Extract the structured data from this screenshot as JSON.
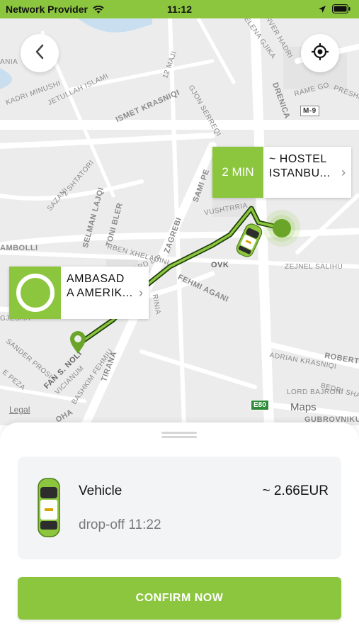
{
  "status": {
    "carrier": "Network Provider",
    "time": "11:12"
  },
  "map": {
    "streets": [
      {
        "name": "KADRI MINUSHI"
      },
      {
        "name": "JETULLAH ISLAMI"
      },
      {
        "name": "ISMET KRASNIQI"
      },
      {
        "name": "12 MAJI"
      },
      {
        "name": "GJON SERREQI"
      },
      {
        "name": "ELENA GJIKA"
      },
      {
        "name": "ENVER HADRI"
      },
      {
        "name": "DRENICA"
      },
      {
        "name": "RAME GO"
      },
      {
        "name": "PRESHE"
      },
      {
        "name": "M-9"
      },
      {
        "name": "2 SHTATORI"
      },
      {
        "name": "SAZANI"
      },
      {
        "name": "SELMAN LAJQI"
      },
      {
        "name": "TONI BLER"
      },
      {
        "name": "ZAGREBI"
      },
      {
        "name": "SAMI PE"
      },
      {
        "name": "VUSHTRRIA"
      },
      {
        "name": "AMBOLLI"
      },
      {
        "name": "RBEN XHELADINI"
      },
      {
        "name": "UARD LIR"
      },
      {
        "name": "OVK"
      },
      {
        "name": "ZEJNEL SALIHU"
      },
      {
        "name": "FEHMI AGANI"
      },
      {
        "name": "RINIA"
      },
      {
        "name": "GJESHA"
      },
      {
        "name": "SANDER PROSI"
      },
      {
        "name": "FAN S. NOLI"
      },
      {
        "name": "VICIANUM"
      },
      {
        "name": "BASHKIM FEHMIU"
      },
      {
        "name": "TIRANA"
      },
      {
        "name": "ADRIAN KRASNIQI"
      },
      {
        "name": "ROBERT"
      },
      {
        "name": "BEDRI SHA"
      },
      {
        "name": "LORD BAJRONI"
      },
      {
        "name": "GUBROVNIKUT"
      },
      {
        "name": "OHA"
      },
      {
        "name": "E PEZA"
      },
      {
        "name": "ANIA"
      }
    ],
    "legal": "Legal",
    "road_badge": "E80",
    "maps_brand": "Maps"
  },
  "pickup_bubble": {
    "eta": "2 MIN",
    "label": "~ HOSTEL ISTANBU..."
  },
  "dest_bubble": {
    "label": "AMBASAD A AMERIK..."
  },
  "ride": {
    "vehicle": "Vehicle",
    "price": "~ 2.66EUR",
    "dropoff": "drop-off 11:22"
  },
  "confirm_label": "CONFIRM NOW",
  "colors": {
    "accent": "#8cc63f",
    "route": "#1f3d0c"
  }
}
